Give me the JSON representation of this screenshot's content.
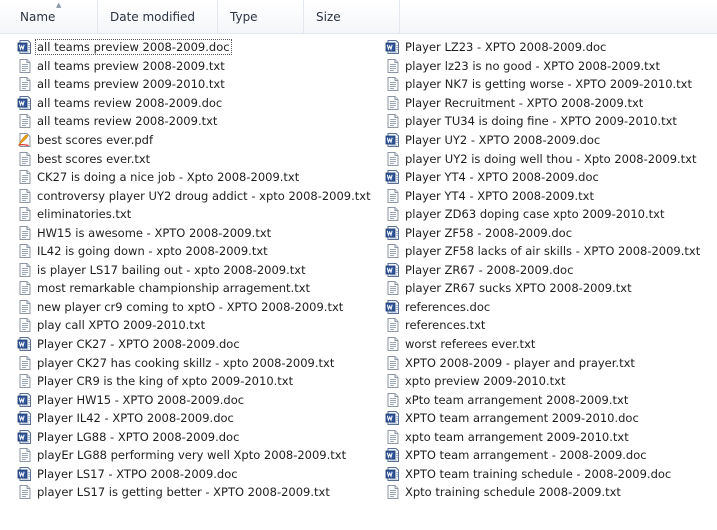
{
  "header": {
    "name": "Name",
    "date_modified": "Date modified",
    "type": "Type",
    "size": "Size"
  },
  "files_left": [
    {
      "name": "all teams preview 2008-2009.doc",
      "icon": "word-doc-icon"
    },
    {
      "name": "all teams preview 2008-2009.txt",
      "icon": "text-file-icon"
    },
    {
      "name": "all teams preview 2009-2010.txt",
      "icon": "text-file-icon"
    },
    {
      "name": "all teams review 2008-2009.doc",
      "icon": "word-doc-icon"
    },
    {
      "name": "all teams review 2008-2009.txt",
      "icon": "text-file-icon"
    },
    {
      "name": "best scores ever.pdf",
      "icon": "pdf-file-icon"
    },
    {
      "name": "best scores ever.txt",
      "icon": "text-file-icon"
    },
    {
      "name": "CK27 is doing a nice job - Xpto 2008-2009.txt",
      "icon": "text-file-icon"
    },
    {
      "name": "controversy player UY2 droug addict - xpto 2008-2009.txt",
      "icon": "text-file-icon"
    },
    {
      "name": "eliminatories.txt",
      "icon": "text-file-icon"
    },
    {
      "name": "HW15 is awesome - XPTO 2008-2009.txt",
      "icon": "text-file-icon"
    },
    {
      "name": "IL42 is going down - xpto 2008-2009.txt",
      "icon": "text-file-icon"
    },
    {
      "name": "is player LS17 bailing out - xpto 2008-2009.txt",
      "icon": "text-file-icon"
    },
    {
      "name": "most remarkable championship arragement.txt",
      "icon": "text-file-icon"
    },
    {
      "name": "new player cr9 coming to xptO - XPTO 2008-2009.txt",
      "icon": "text-file-icon"
    },
    {
      "name": "play call XPTO 2009-2010.txt",
      "icon": "text-file-icon"
    },
    {
      "name": "Player CK27 - XPTO 2008-2009.doc",
      "icon": "word-doc-icon"
    },
    {
      "name": "player CK27 has cooking skillz - xpto 2008-2009.txt",
      "icon": "text-file-icon"
    },
    {
      "name": "Player CR9 is the king of xpto 2009-2010.txt",
      "icon": "text-file-icon"
    },
    {
      "name": "Player HW15 - XPTO 2008-2009.doc",
      "icon": "word-doc-icon"
    },
    {
      "name": "Player IL42 - XPTO 2008-2009.doc",
      "icon": "word-doc-icon"
    },
    {
      "name": "Player LG88 - XPTO 2008-2009.doc",
      "icon": "word-doc-icon"
    },
    {
      "name": "playEr LG88 performing very well Xpto 2008-2009.txt",
      "icon": "text-file-icon"
    },
    {
      "name": "Player LS17 - XTPO 2008-2009.doc",
      "icon": "word-doc-icon"
    },
    {
      "name": "player LS17 is getting better - XPTO 2008-2009.txt",
      "icon": "text-file-icon"
    }
  ],
  "files_right": [
    {
      "name": "Player LZ23 - XPTO 2008-2009.doc",
      "icon": "word-doc-icon"
    },
    {
      "name": "player lz23 is no good - XPTO 2008-2009.txt",
      "icon": "text-file-icon"
    },
    {
      "name": "player NK7 is getting worse - XPTO 2009-2010.txt",
      "icon": "text-file-icon"
    },
    {
      "name": "Player Recruitment - XPTO 2008-2009.txt",
      "icon": "text-file-icon"
    },
    {
      "name": "player TU34 is doing fine - XPTO 2009-2010.txt",
      "icon": "text-file-icon"
    },
    {
      "name": "Player UY2 - XPTO 2008-2009.doc",
      "icon": "word-doc-icon"
    },
    {
      "name": "player UY2 is doing well thou - Xpto 2008-2009.txt",
      "icon": "text-file-icon"
    },
    {
      "name": "Player YT4 - XPTO 2008-2009.doc",
      "icon": "word-doc-icon"
    },
    {
      "name": "Player YT4 - XPTO 2008-2009.txt",
      "icon": "text-file-icon"
    },
    {
      "name": "player ZD63 doping case xpto 2009-2010.txt",
      "icon": "text-file-icon"
    },
    {
      "name": "Player ZF58 - 2008-2009.doc",
      "icon": "word-doc-icon"
    },
    {
      "name": "player ZF58 lacks of air skills - XPTO 2008-2009.txt",
      "icon": "text-file-icon"
    },
    {
      "name": "Player ZR67 - 2008-2009.doc",
      "icon": "word-doc-icon"
    },
    {
      "name": "player ZR67 sucks XPTO 2008-2009.txt",
      "icon": "text-file-icon"
    },
    {
      "name": "references.doc",
      "icon": "word-doc-icon"
    },
    {
      "name": "references.txt",
      "icon": "text-file-icon"
    },
    {
      "name": "worst referees ever.txt",
      "icon": "text-file-icon"
    },
    {
      "name": "XPTO 2008-2009 - player and prayer.txt",
      "icon": "text-file-icon"
    },
    {
      "name": "xpto preview 2009-2010.txt",
      "icon": "text-file-icon"
    },
    {
      "name": "xPto team arrangement 2008-2009.txt",
      "icon": "text-file-icon"
    },
    {
      "name": "XPTO team arrangement 2009-2010.doc",
      "icon": "word-doc-icon"
    },
    {
      "name": "xpto team arrangement 2009-2010.txt",
      "icon": "text-file-icon"
    },
    {
      "name": "XPTO team arrangement - 2008-2009.doc",
      "icon": "word-doc-icon"
    },
    {
      "name": "XPTO team training schedule - 2008-2009.doc",
      "icon": "word-doc-icon"
    },
    {
      "name": "Xpto training schedule 2008-2009.txt",
      "icon": "text-file-icon"
    }
  ]
}
